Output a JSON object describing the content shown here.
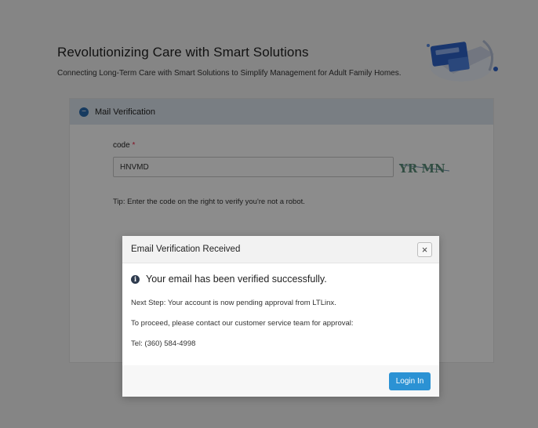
{
  "hero": {
    "title": "Revolutionizing Care with Smart Solutions",
    "subtitle": "Connecting Long-Term Care with Smart Solutions to Simplify Management for Adult Family Homes."
  },
  "panel": {
    "title": "Mail Verification",
    "code_label": "code",
    "required_mark": "*",
    "code_value": "HNVMD",
    "captcha_text": "YR MN",
    "tip": "Tip: Enter the code on the right to verify you're not a robot."
  },
  "modal": {
    "title": "Email Verification Received",
    "close_symbol": "×",
    "info_symbol": "i",
    "success_message": "Your email has been verified successfully.",
    "line1": "Next Step: Your account is now pending approval from LTLinx.",
    "line2": "To proceed, please contact our customer service team for approval:",
    "line3": "Tel: (360) 584-4998",
    "login_label": "Login In"
  },
  "colors": {
    "accent": "#2b92d4",
    "panel_header": "#dde5ee",
    "overlay": "rgba(0,0,0,0.45)"
  }
}
